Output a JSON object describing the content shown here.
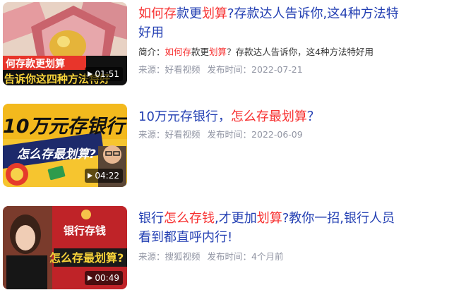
{
  "results": [
    {
      "title_parts": [
        {
          "text": "如何存",
          "hl": true
        },
        {
          "text": "款更",
          "hl": false
        },
        {
          "text": "划算",
          "hl": true
        },
        {
          "text": "?存款达人告诉你,这4种方法特好用",
          "hl": false
        }
      ],
      "summary_prefix": "简介：",
      "summary_parts": [
        {
          "text": "如何存",
          "hl": true
        },
        {
          "text": "款更",
          "hl": false
        },
        {
          "text": "划算",
          "hl": true
        },
        {
          "text": "？存款达人告诉你，这4种方法特好用",
          "hl": false
        }
      ],
      "source_label": "来源：",
      "source": "好看视频",
      "date_label": "发布时间：",
      "date": "2022-07-21",
      "duration": "01:51",
      "thumb_caption_1": "何存款更划算",
      "thumb_caption_2": "告诉你这四种方法特好"
    },
    {
      "title_parts": [
        {
          "text": "10万元存银行，",
          "hl": false
        },
        {
          "text": "怎么存最划算",
          "hl": true
        },
        {
          "text": "？",
          "hl": false
        }
      ],
      "source_label": "来源：",
      "source": "好看视频",
      "date_label": "发布时间：",
      "date": "2022-06-09",
      "duration": "04:22",
      "thumb_caption_1": "10万元存银行",
      "thumb_caption_2": "怎么存最划算?"
    },
    {
      "title_parts": [
        {
          "text": "银行",
          "hl": false
        },
        {
          "text": "怎么存钱",
          "hl": true
        },
        {
          "text": ",才更加",
          "hl": false
        },
        {
          "text": "划算",
          "hl": true
        },
        {
          "text": "?教你一招,银行人员看到都直呼内行!",
          "hl": false
        }
      ],
      "source_label": "来源：",
      "source": "搜狐视频",
      "date_label": "发布时间：",
      "date": "4个月前",
      "duration": "00:49",
      "thumb_caption_1": "银行存钱",
      "thumb_caption_2": "怎么存最划算?"
    }
  ],
  "colors": {
    "title_link": "#2440b3",
    "highlight": "#f73131",
    "meta": "#9195a3",
    "summary": "#333333"
  }
}
